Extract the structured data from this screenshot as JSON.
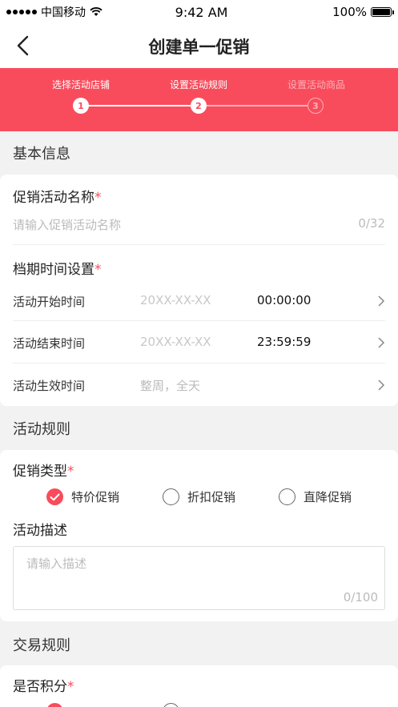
{
  "status_bar": {
    "carrier": "中国移动",
    "time": "9:42 AM",
    "battery": "100%"
  },
  "nav": {
    "title": "创建单一促销"
  },
  "steps": [
    {
      "label": "选择活动店铺",
      "number": "1",
      "state": "done"
    },
    {
      "label": "设置活动规则",
      "number": "2",
      "state": "current"
    },
    {
      "label": "设置活动商品",
      "number": "3",
      "state": "todo"
    }
  ],
  "basic_info": {
    "section_title": "基本信息",
    "name_label": "促销活动名称",
    "required_mark": "*",
    "name_placeholder": "请输入促销活动名称",
    "name_counter": "0/32",
    "schedule_label": "档期时间设置",
    "rows": [
      {
        "label": "活动开始时间",
        "date": "20XX-XX-XX",
        "time": "00:00:00"
      },
      {
        "label": "活动结束时间",
        "date": "20XX-XX-XX",
        "time": "23:59:59"
      },
      {
        "label": "活动生效时间",
        "value": "整周，全天"
      }
    ]
  },
  "rules": {
    "section_title": "活动规则",
    "type_label": "促销类型",
    "options": [
      {
        "label": "特价促销",
        "checked": true
      },
      {
        "label": "折扣促销",
        "checked": false
      },
      {
        "label": "直降促销",
        "checked": false
      }
    ],
    "desc_label": "活动描述",
    "desc_placeholder": "请输入描述",
    "desc_counter": "0/100"
  },
  "trade_rules": {
    "section_title": "交易规则",
    "points_label": "是否积分"
  },
  "colors": {
    "accent": "#f84c5c",
    "background": "#f2f2f2"
  }
}
